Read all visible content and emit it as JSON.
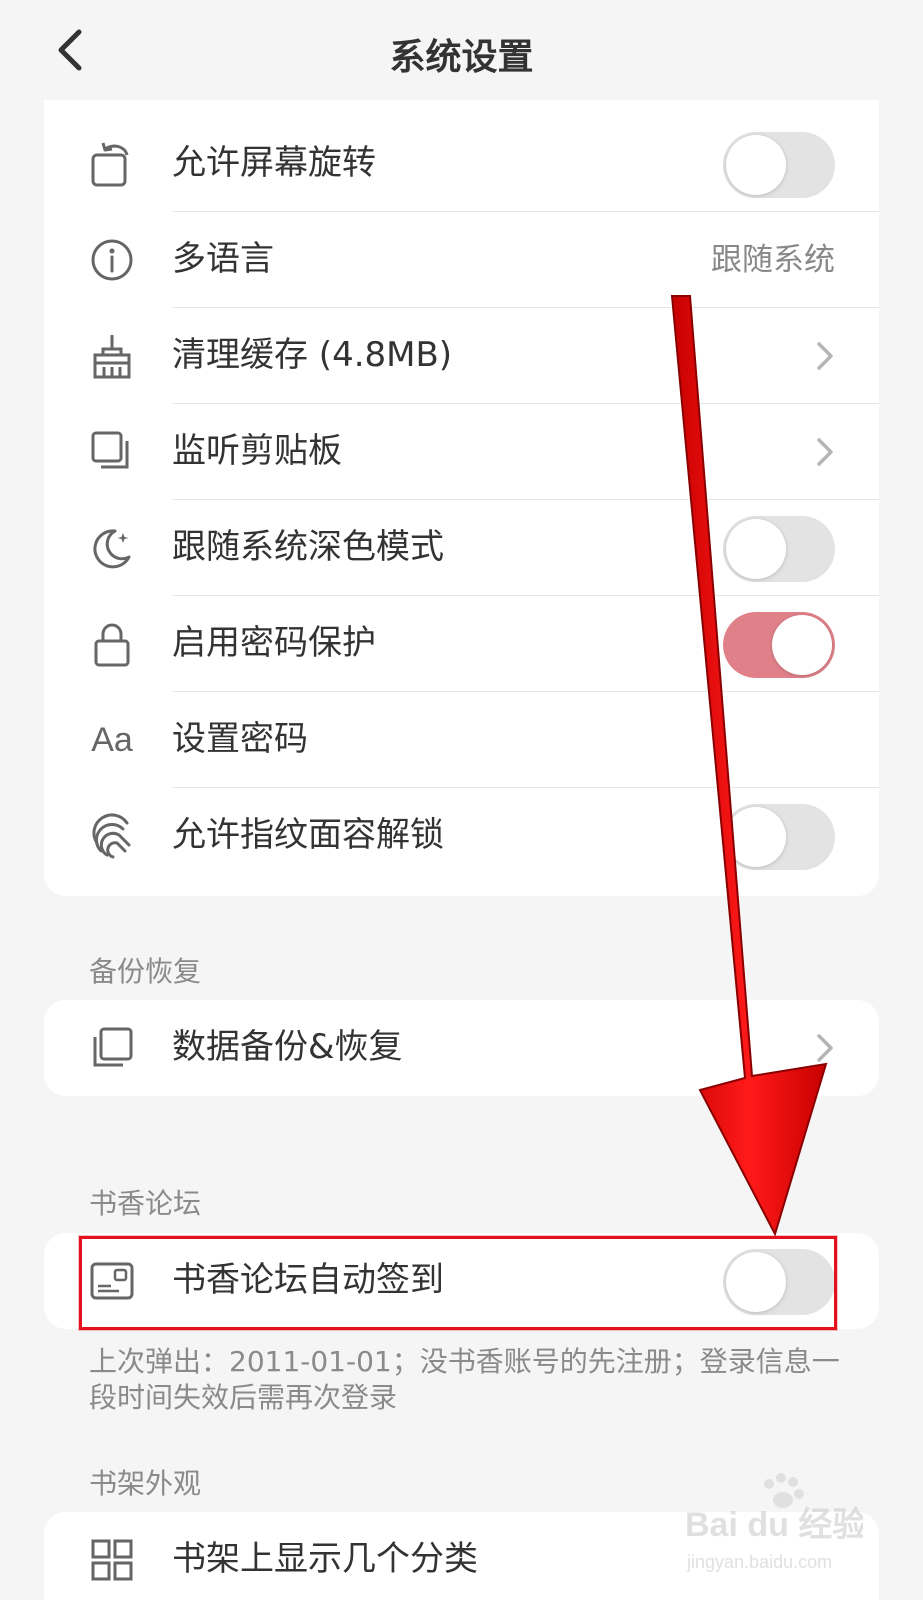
{
  "header": {
    "title": "系统设置"
  },
  "settings_card": {
    "rows": [
      {
        "label": "允许屏幕旋转",
        "control": "toggle",
        "state": "off"
      },
      {
        "label": "多语言",
        "value": "跟随系统"
      },
      {
        "label": "清理缓存 (4.8MB)",
        "control": "chevron"
      },
      {
        "label": "监听剪贴板",
        "control": "chevron"
      },
      {
        "label": "跟随系统深色模式",
        "control": "toggle",
        "state": "off"
      },
      {
        "label": "启用密码保护",
        "control": "toggle",
        "state": "on"
      },
      {
        "label": "设置密码",
        "icon_text": "Aa"
      },
      {
        "label": "允许指纹面容解锁",
        "control": "toggle",
        "state": "off"
      }
    ]
  },
  "backup_section": {
    "title": "备份恢复",
    "row_label": "数据备份&恢复"
  },
  "forum_section": {
    "title": "书香论坛",
    "row_label": "书香论坛自动签到",
    "toggle_state": "off",
    "note": "上次弹出：2011-01-01；没书香账号的先注册；登录信息一段时间失效后需再次登录"
  },
  "shelf_section": {
    "title": "书架外观",
    "row_label": "书架上显示几个分类"
  },
  "watermark": {
    "brand": "Bai du 经验",
    "site": "jingyan.baidu.com"
  },
  "colors": {
    "toggle_on": "#e0818a",
    "highlight": "#e5101e",
    "arrow": "#ff0000"
  }
}
